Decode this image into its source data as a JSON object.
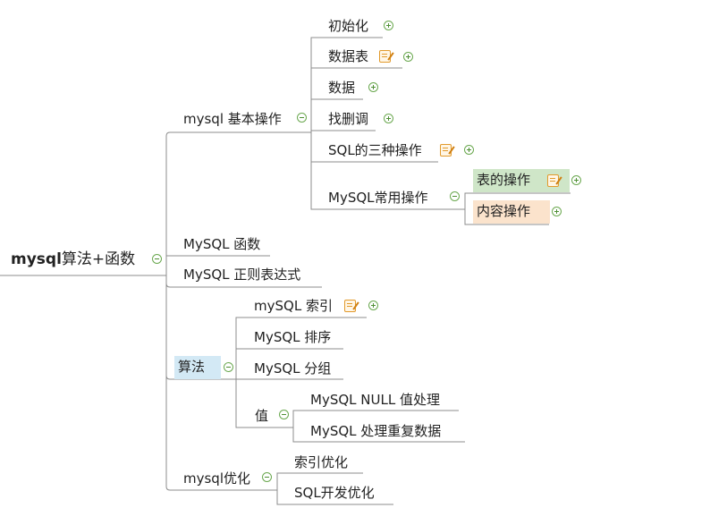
{
  "root": {
    "bold": "mysql",
    "rest": "算法+函数"
  },
  "nodes": {
    "basic_ops": "mysql 基本操作",
    "init": "初始化",
    "data_table": "数据表",
    "data": "数据",
    "find_delete_update": "找删调",
    "sql_three_ops": "SQL的三种操作",
    "mysql_common_ops": "MySQL常用操作",
    "table_ops": "表的操作",
    "content_ops": "内容操作",
    "mysql_func": "MySQL 函数",
    "mysql_regex": "MySQL 正则表达式",
    "algorithm": "算法",
    "mysql_index": "mySQL 索引",
    "mysql_sort": "MySQL 排序",
    "mysql_group": "MySQL 分组",
    "value": "值",
    "mysql_null": "MySQL NULL 值处理",
    "mysql_dup": "MySQL 处理重复数据",
    "mysql_opt": "mysql优化",
    "index_opt": "索引优化",
    "sql_dev_opt": "SQL开发优化"
  },
  "colors": {
    "line": "#8c8c8c",
    "toggle": "#6aa84f",
    "note": "#e29a2c",
    "highlight_green": "#cfe6c8",
    "highlight_orange": "#fbe3cc",
    "highlight_blue": "#d3e9f5"
  }
}
